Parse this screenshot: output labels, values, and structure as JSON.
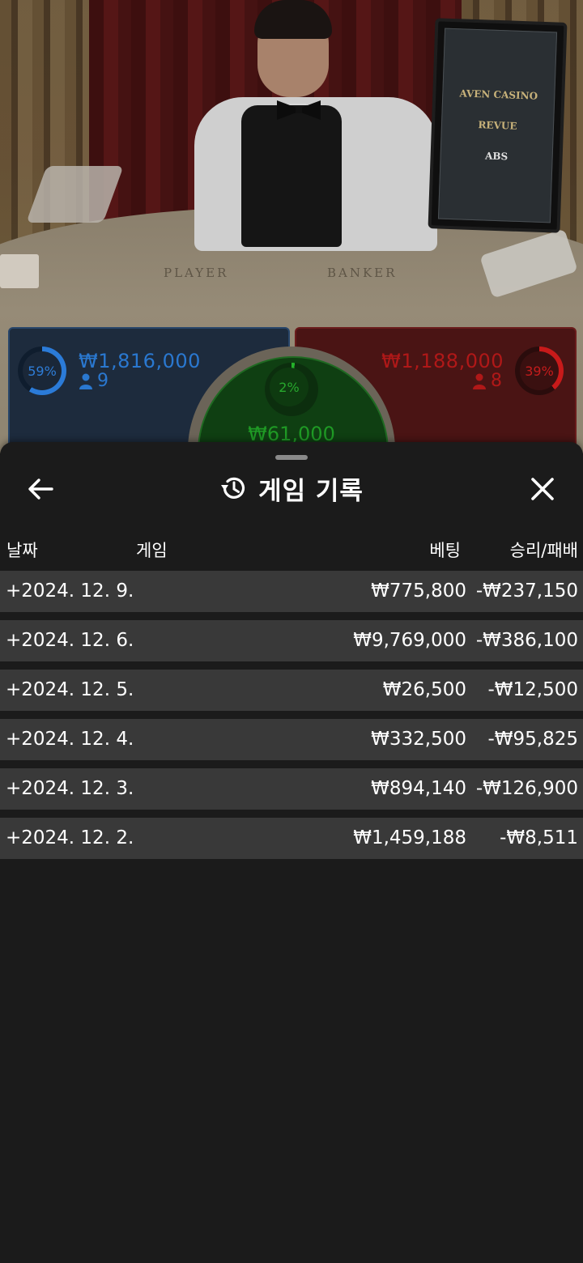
{
  "video": {
    "table_labels": [
      "PLAYER",
      "BANKER"
    ],
    "sponsors": [
      "AVEN CASINO",
      "REVUE",
      "ABS"
    ]
  },
  "bets": {
    "player": {
      "percent": "59%",
      "amount": "₩1,816,000",
      "count": "9",
      "color": "#2b7bd8"
    },
    "banker": {
      "percent": "39%",
      "amount": "₩1,188,000",
      "count": "8",
      "color": "#c81a1a"
    },
    "tie": {
      "percent": "2%",
      "amount": "₩61,000",
      "color": "#24b22a"
    }
  },
  "sheet": {
    "title": "게임 기록",
    "icons": {
      "back": "arrow-left-icon",
      "history": "history-icon",
      "close": "close-icon"
    },
    "columns": {
      "date": "날짜",
      "game": "게임",
      "bet": "베팅",
      "result": "승리/패배"
    },
    "rows": [
      {
        "date": "+2024. 12. 9.",
        "bet": "₩775,800",
        "result": "-₩237,150"
      },
      {
        "date": "+2024. 12. 6.",
        "bet": "₩9,769,000",
        "result": "-₩386,100"
      },
      {
        "date": "+2024. 12. 5.",
        "bet": "₩26,500",
        "result": "-₩12,500"
      },
      {
        "date": "+2024. 12. 4.",
        "bet": "₩332,500",
        "result": "-₩95,825"
      },
      {
        "date": "+2024. 12. 3.",
        "bet": "₩894,140",
        "result": "-₩126,900"
      },
      {
        "date": "+2024. 12. 2.",
        "bet": "₩1,459,188",
        "result": "-₩8,511"
      }
    ]
  }
}
